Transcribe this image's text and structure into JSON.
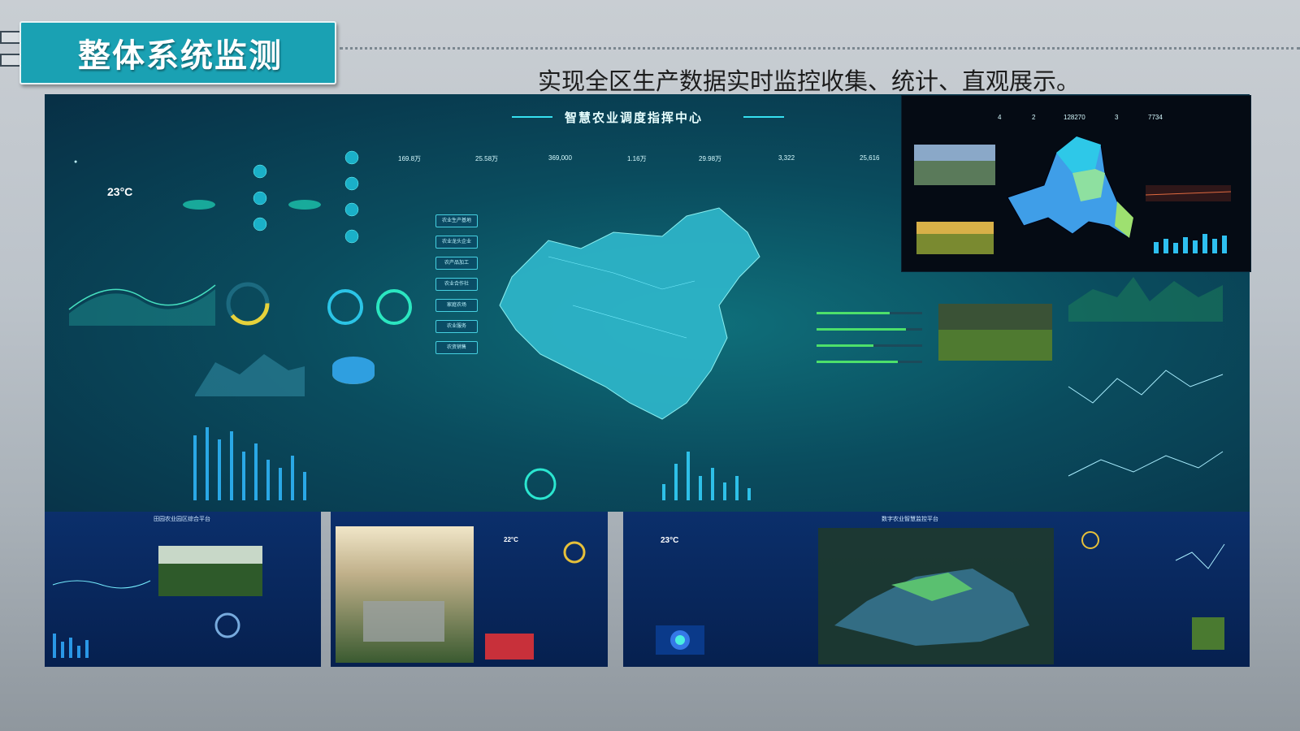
{
  "header": {
    "title": "整体系统监测",
    "subtitle": "实现全区生产数据实时监控收集、统计、直观展示。"
  },
  "dashboard": {
    "title": "智慧农业调度指挥中心",
    "weather_temp": "23°C",
    "stats": [
      "169.8万",
      "25.58万",
      "369,000",
      "1.16万",
      "29.98万",
      "3,322",
      "25,616"
    ],
    "menu_buttons": [
      "农业生产基地",
      "农业龙头企业",
      "农产品加工",
      "农业合作社",
      "家庭农场",
      "农业服务",
      "农资销售"
    ]
  },
  "inset": {
    "stats": [
      "4",
      "2",
      "128270",
      "3",
      "7734"
    ]
  },
  "bottom_panels": {
    "panel1_title": "田园农业园区综合平台",
    "panel3_title": "数字农业智慧监控平台",
    "panel3_temp": "23°C",
    "panel2_temp": "22°C"
  },
  "colors": {
    "title_box": "#1aa1b3",
    "dashboard_bg": "#0a4c5e",
    "accent": "#36e0f0",
    "map_fill": "#3fd0e0"
  }
}
